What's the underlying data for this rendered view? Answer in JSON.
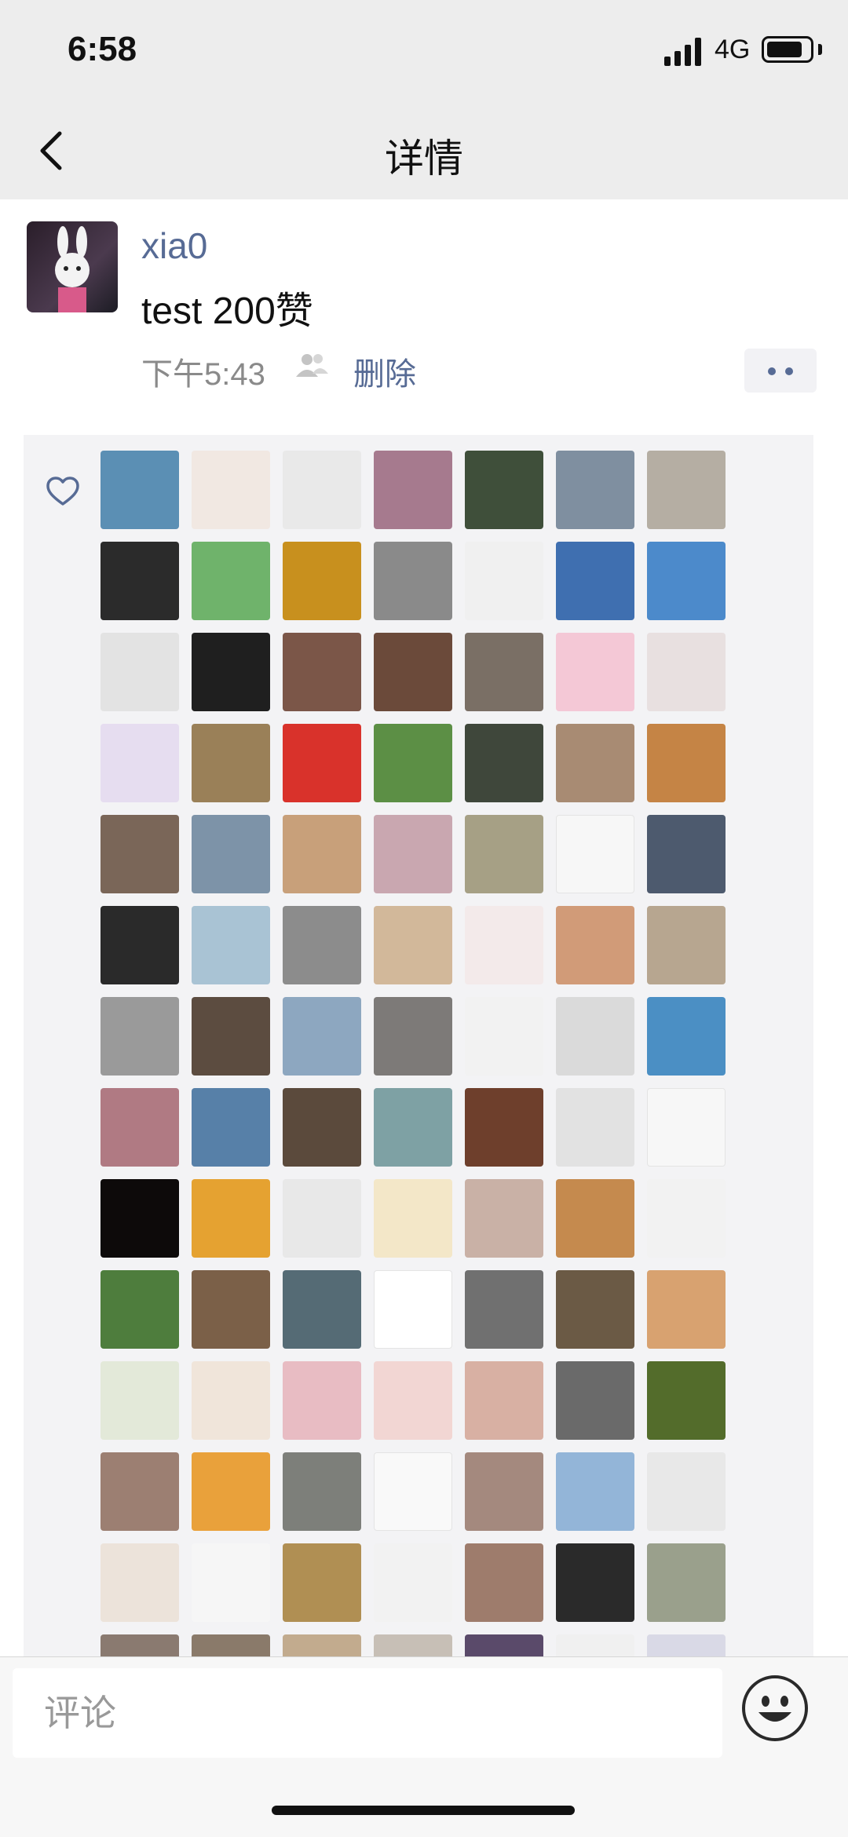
{
  "status_bar": {
    "time": "6:58",
    "network": "4G"
  },
  "nav": {
    "title": "详情"
  },
  "post": {
    "username": "xia0",
    "text": "test 200赞",
    "time": "下午5:43",
    "delete_label": "删除"
  },
  "likes": {
    "avatar_colors": [
      "#5b8fb4",
      "#f1e8e2",
      "#e9e9e9",
      "#a67a8e",
      "#3f4f3a",
      "#7f8fa0",
      "#b5aea3",
      "#2b2b2b",
      "#6fb36b",
      "#c8901e",
      "#8a8a8a",
      "#f0f0f0",
      "#3f6fb0",
      "#4c8acb",
      "#e3e3e3",
      "#1f1f1f",
      "#7b5648",
      "#6b4a3a",
      "#7a6f65",
      "#f4c8d6",
      "#e8e0e0",
      "#e6ddf0",
      "#9a8058",
      "#d9322b",
      "#5c8f45",
      "#3f473b",
      "#a88b73",
      "#c58445",
      "#7a6658",
      "#7d93a8",
      "#c8a07a",
      "#c9a7b0",
      "#a6a085",
      "#f7f7f7",
      "#4d5a6e",
      "#2a2a2a",
      "#a9c3d4",
      "#8c8c8c",
      "#d2b89a",
      "#f3eaea",
      "#d19b78",
      "#b7a690",
      "#9a9a9a",
      "#5c4c40",
      "#8da7c0",
      "#7d7a78",
      "#f2f2f2",
      "#dadada",
      "#4b8fc4",
      "#b07a83",
      "#5780a8",
      "#5b4a3c",
      "#7ea1a4",
      "#6e3f2c",
      "#e2e2e2",
      "#f7f7f7",
      "#0d0a0a",
      "#e5a231",
      "#e8e8e8",
      "#f3e7c8",
      "#c9b1a6",
      "#c58a4e",
      "#f2f2f2",
      "#4e7d3d",
      "#7b6048",
      "#556b75",
      "#ffffff",
      "#707070",
      "#6b5a45",
      "#d8a270",
      "#e3e9d9",
      "#f0e5da",
      "#e8bcc3",
      "#f2d6d3",
      "#d8b0a3",
      "#6a6a6a",
      "#536c2b",
      "#9c7f72",
      "#e9a13b",
      "#7d7f7a",
      "#f9f9f9",
      "#a4897e",
      "#93b5d8",
      "#e8e8e8",
      "#ece3da",
      "#f6f6f6",
      "#b08f53",
      "#f2f2f2",
      "#9e7c6c",
      "#2a2a2a",
      "#9aa08c",
      "#8a7a70",
      "#8a7a6a",
      "#c2ab8e",
      "#c7bfb6",
      "#5a4a6a",
      "#f0f0f0",
      "#d9d9e6"
    ]
  },
  "comment": {
    "placeholder": "评论"
  }
}
